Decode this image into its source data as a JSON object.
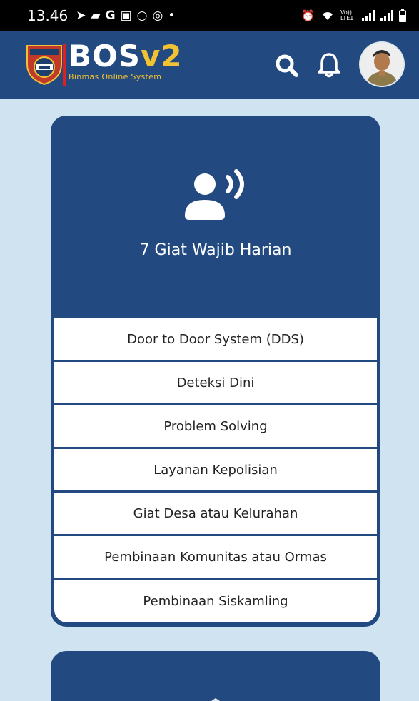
{
  "status_bar": {
    "time": "13.46",
    "left_icons": [
      "location-arrow-icon",
      "chat-icon",
      "google-icon",
      "gallery-icon",
      "circle-icon",
      "hotspot-icon"
    ],
    "right_icons": [
      "alarm-icon",
      "wifi-icon",
      "volte-icon",
      "signal-icon",
      "signal-icon",
      "battery-icon"
    ],
    "volte_text": "Vo)) LTE1"
  },
  "app_bar": {
    "brand_main": "BOS",
    "brand_version": "v2",
    "brand_subtitle": "Binmas Online System",
    "background": "#234a80",
    "accent": "#f1c232"
  },
  "card": {
    "icon": "user-speaking-icon",
    "title": "7 Giat Wajib Harian",
    "items": [
      {
        "label": "Door to Door System (DDS)"
      },
      {
        "label": "Deteksi Dini"
      },
      {
        "label": "Problem Solving"
      },
      {
        "label": "Layanan Kepolisian"
      },
      {
        "label": "Giat Desa atau Kelurahan"
      },
      {
        "label": "Pembinaan Komunitas atau Ormas"
      },
      {
        "label": "Pembinaan Siskamling"
      }
    ]
  }
}
